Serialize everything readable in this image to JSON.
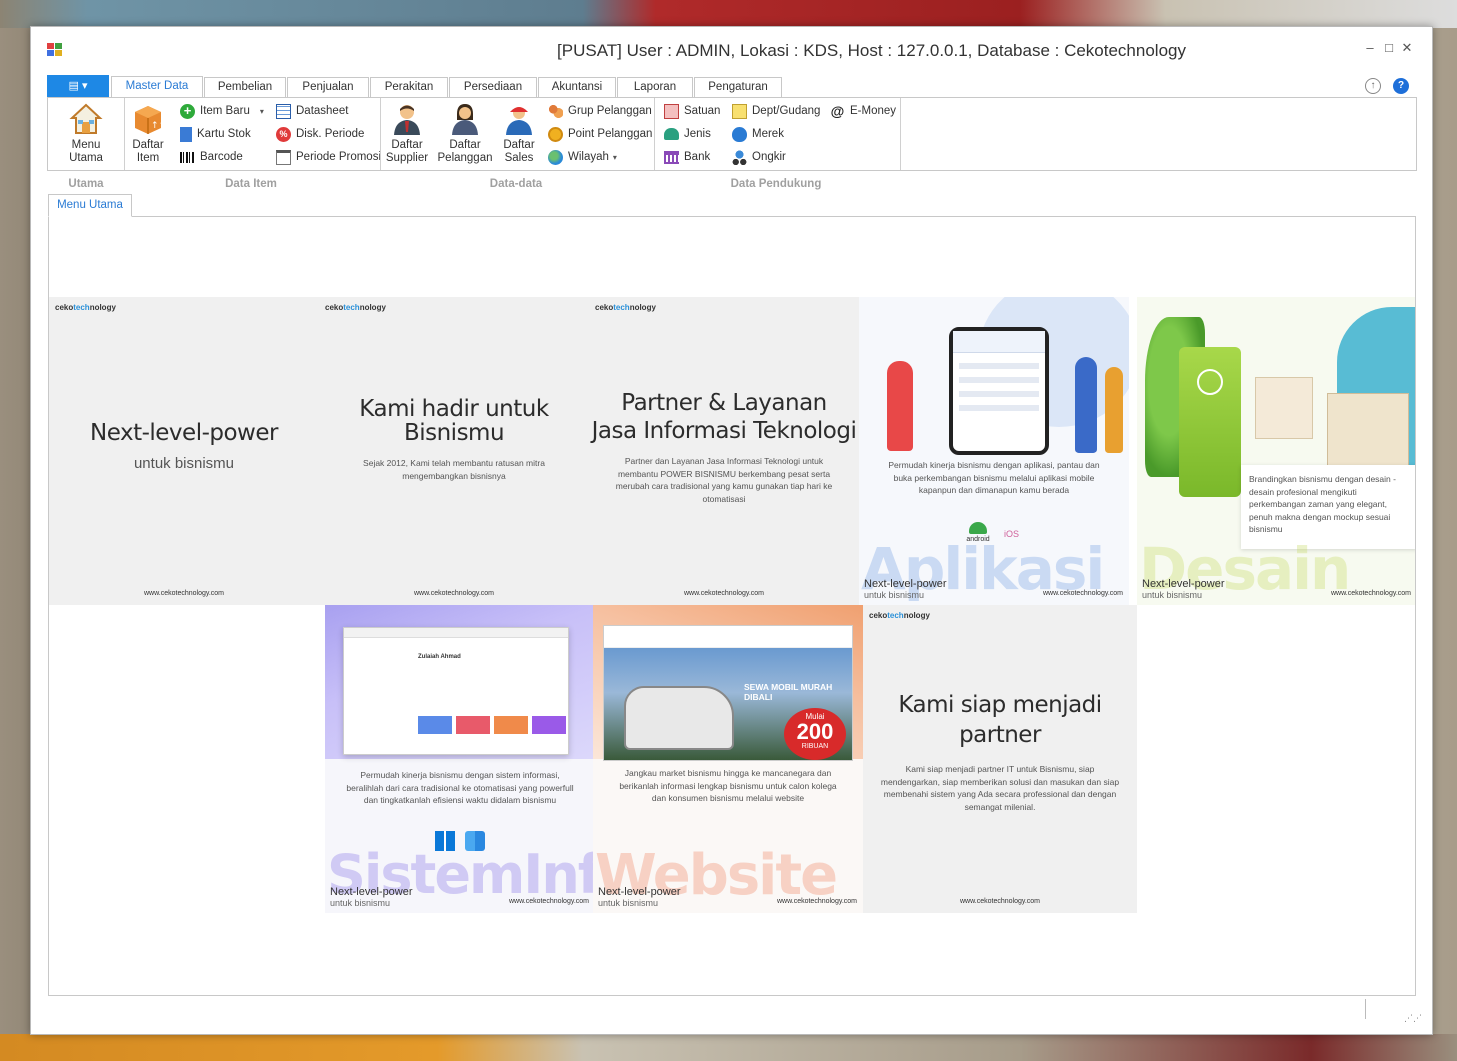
{
  "window": {
    "title": "[PUSAT] User : ADMIN, Lokasi : KDS, Host : 127.0.0.1, Database : Cekotechnology",
    "minimize": "–",
    "maximize": "□",
    "close": "✕"
  },
  "ribbon_tabs": [
    "Master Data",
    "Pembelian",
    "Penjualan",
    "Perakitan",
    "Persediaan",
    "Akuntansi",
    "Laporan",
    "Pengaturan"
  ],
  "active_tab": "Master Data",
  "app_button": "▤ ▾",
  "ribbon": {
    "utama": {
      "label": "Utama",
      "menu_utama": "Menu Utama"
    },
    "data_item": {
      "label": "Data Item",
      "daftar_item_1": "Daftar",
      "daftar_item_2": "Item",
      "item_baru": "Item Baru",
      "kartu_stok": "Kartu Stok",
      "barcode": "Barcode",
      "datasheet": "Datasheet",
      "disk_periode": "Disk. Periode",
      "periode_promosi": "Periode Promosi"
    },
    "data_data": {
      "label": "Data-data",
      "daftar_supplier_1": "Daftar",
      "daftar_supplier_2": "Supplier",
      "daftar_pelanggan_1": "Daftar",
      "daftar_pelanggan_2": "Pelanggan",
      "daftar_sales_1": "Daftar",
      "daftar_sales_2": "Sales",
      "grup_pelanggan": "Grup Pelanggan",
      "point_pelanggan": "Point Pelanggan",
      "wilayah": "Wilayah"
    },
    "data_pendukung": {
      "label": "Data Pendukung",
      "satuan": "Satuan",
      "jenis": "Jenis",
      "bank": "Bank",
      "dept_gudang": "Dept/Gudang",
      "merek": "Merek",
      "ongkir": "Ongkir",
      "emoney": "E-Money"
    }
  },
  "document_tab": "Menu Utama",
  "tiles": {
    "brand_a": "ceko",
    "brand_b": "tech",
    "brand_c": "nology",
    "url": "www.cekotechnology.com",
    "t1": {
      "head": "Next-level-power",
      "sub": "untuk bisnismu"
    },
    "t2": {
      "head1": "Kami hadir untuk",
      "head2": "Bisnismu",
      "sub": "Sejak 2012, Kami telah membantu ratusan mitra mengembangkan bisnisnya"
    },
    "t3": {
      "head1": "Partner & Layanan",
      "head2": "Jasa Informasi Teknologi",
      "sub": "Partner dan Layanan Jasa Informasi Teknologi untuk membantu POWER BISNISMU berkembang pesat serta merubah cara tradisional yang kamu gunakan tiap hari ke otomatisasi"
    },
    "t4": {
      "sub": "Permudah kinerja bisnismu dengan aplikasi, pantau dan buka perkembangan bisnismu melalui aplikasi mobile kapanpun dan dimanapun kamu berada",
      "big": "Aplikasi",
      "android": "android",
      "ios": "iOS"
    },
    "t5": {
      "sub": "Brandingkan bisnismu dengan desain - desain profesional mengikuti perkembangan zaman yang elegant, penuh makna dengan mockup sesuai bisnismu",
      "big": "Desain"
    },
    "t6": {
      "sub": "Permudah kinerja bisnismu dengan sistem informasi, beralihlah dari cara tradisional ke otomatisasi yang powerfull dan tingkatkanlah efisiensi waktu didalam bisnismu",
      "big": "SistemInfo",
      "user": "Zulaiah Ahmad"
    },
    "t7": {
      "sub": "Jangkau market bisnismu hingga ke mancanegara dan berikanlah informasi lengkap bisnismu untuk calon kolega dan konsumen bisnismu melalui website",
      "big": "Website",
      "promo": "SEWA MOBIL MURAH DIBALI",
      "mulai": "Mulai",
      "price": "200",
      "ribuan": "RIBUAN"
    },
    "t8": {
      "head1": "Kami siap menjadi",
      "head2": "partner",
      "sub": "Kami siap menjadi partner IT untuk Bisnismu, siap mendengarkan, siap memberikan solusi dan masukan dan siap membenahi sistem yang Ada secara professional dan dengan semangat milenial."
    },
    "nlp_title": "Next-level-power",
    "nlp_sub": "untuk bisnismu"
  },
  "colors": {
    "accent": "#1e88e5",
    "tab_active_text": "#2a7bd4",
    "aplikasi": "#9db8e8",
    "desain": "#c8e08a",
    "sisteminfo": "#b4a8f0",
    "website": "#f0a080"
  }
}
